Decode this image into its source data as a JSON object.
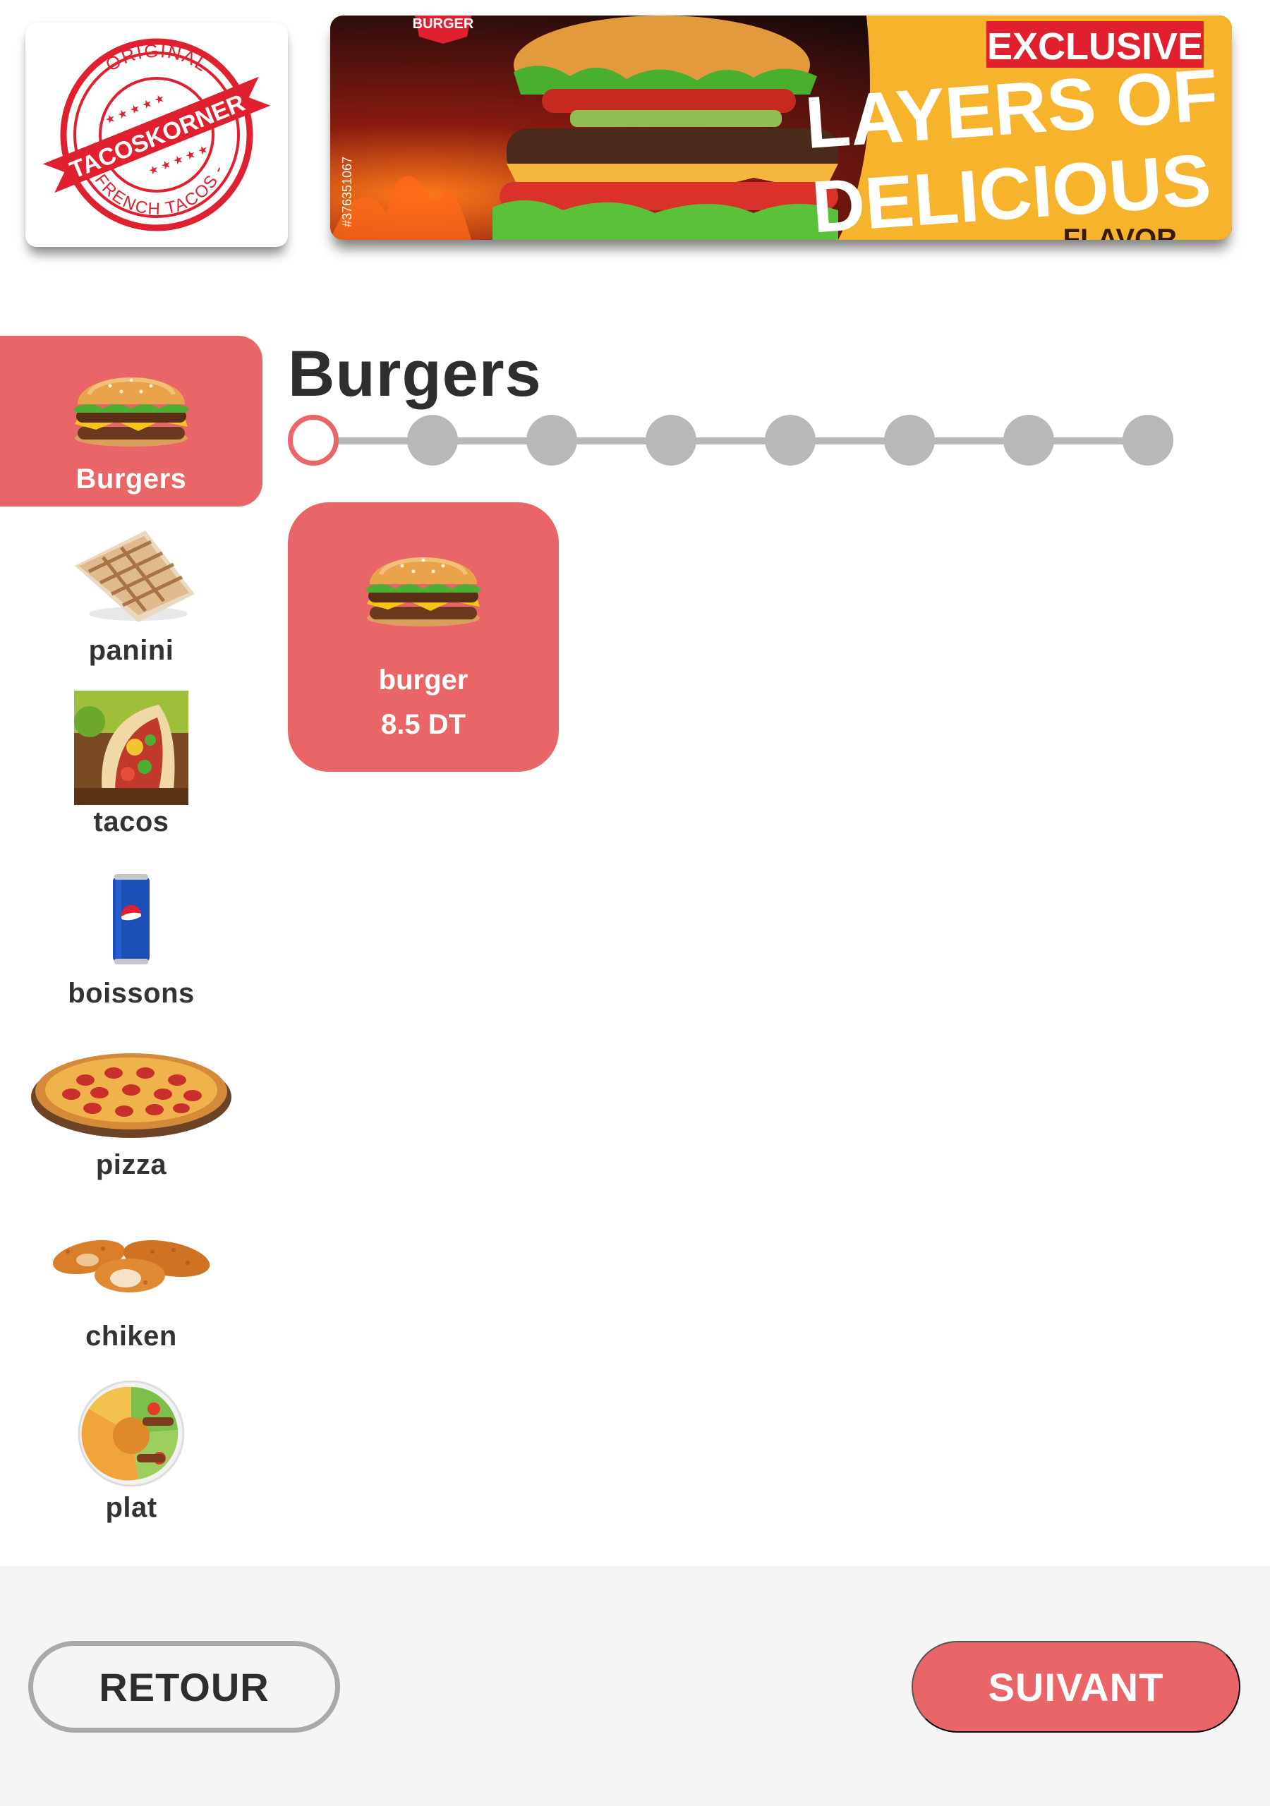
{
  "header": {
    "logo_text": {
      "top_arc": "ORIGINAL",
      "brand": "TACOSKORNER",
      "bottom_arc": "FRENCH TACOS"
    },
    "banner": {
      "tag": "BURGER",
      "line1": "EXCLUSIVE",
      "line2": "LAYERS OF",
      "line3": "DELICIOUS",
      "line4": "FLAVOR",
      "stock_id": "#376351067"
    }
  },
  "sidebar": {
    "items": [
      {
        "label": "Burgers",
        "icon": "burger-icon",
        "active": true
      },
      {
        "label": "panini",
        "icon": "panini-icon",
        "active": false
      },
      {
        "label": "tacos",
        "icon": "tacos-icon",
        "active": false
      },
      {
        "label": "boissons",
        "icon": "soda-can-icon",
        "active": false
      },
      {
        "label": "pizza",
        "icon": "pizza-icon",
        "active": false
      },
      {
        "label": "chiken",
        "icon": "chicken-icon",
        "active": false
      },
      {
        "label": "plat",
        "icon": "plate-icon",
        "active": false
      }
    ]
  },
  "main": {
    "title": "Burgers",
    "stepper": {
      "total_steps": 8,
      "current_step": 1
    },
    "products": [
      {
        "name": "burger",
        "price": "8.5 DT",
        "icon": "burger-icon"
      }
    ]
  },
  "footer": {
    "back_label": "RETOUR",
    "next_label": "SUIVANT"
  },
  "colors": {
    "accent": "#ea6568",
    "step_inactive": "#b8b8b8",
    "text_dark": "#2e2e2e",
    "footer_bg": "#f5f5f5"
  }
}
